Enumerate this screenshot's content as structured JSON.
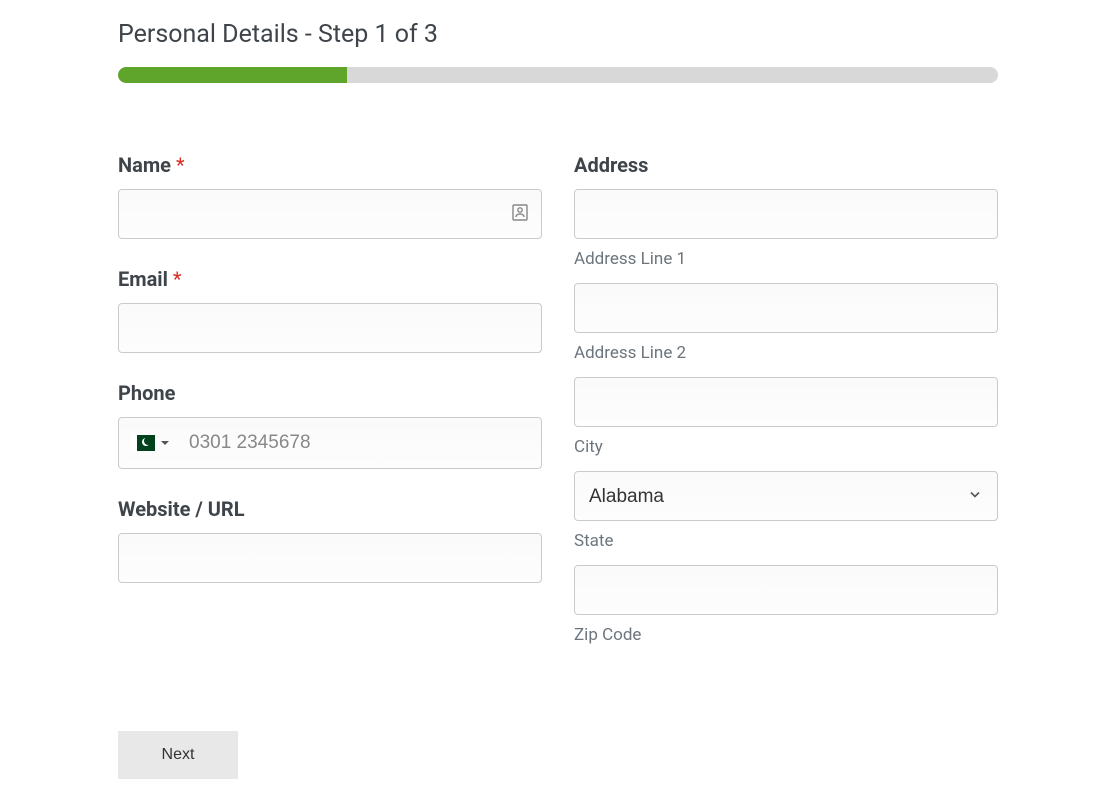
{
  "header": {
    "title": "Personal Details - Step 1 of 3"
  },
  "progress": {
    "percent": 26
  },
  "colors": {
    "progress_fill": "#5fa52c",
    "progress_bg": "#d8d8d8",
    "required": "#d93025"
  },
  "form": {
    "name": {
      "label": "Name",
      "required_mark": "*",
      "value": ""
    },
    "email": {
      "label": "Email",
      "required_mark": "*",
      "value": ""
    },
    "phone": {
      "label": "Phone",
      "placeholder": "0301 2345678",
      "value": "",
      "country_icon": "pakistan-flag"
    },
    "website": {
      "label": "Website / URL",
      "value": ""
    },
    "address": {
      "label": "Address",
      "line1": {
        "value": "",
        "sublabel": "Address Line 1"
      },
      "line2": {
        "value": "",
        "sublabel": "Address Line 2"
      },
      "city": {
        "value": "",
        "sublabel": "City"
      },
      "state": {
        "selected": "Alabama",
        "sublabel": "State"
      },
      "zip": {
        "value": "",
        "sublabel": "Zip Code"
      }
    }
  },
  "buttons": {
    "next": "Next"
  }
}
